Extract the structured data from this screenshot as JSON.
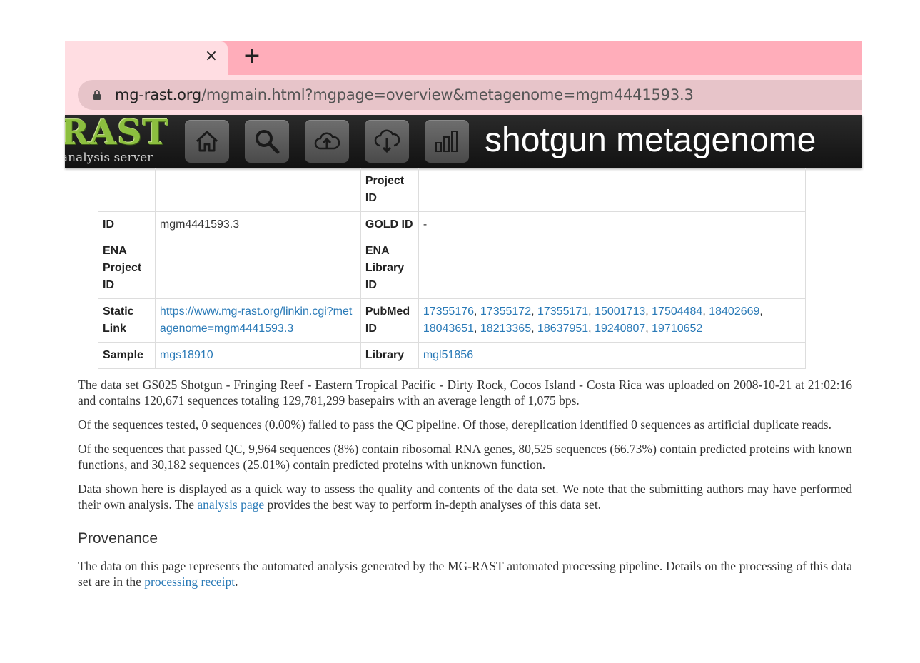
{
  "browser": {
    "tab_close_glyph": "×",
    "new_tab_glyph": "+",
    "url_host": "mg-rast.org",
    "url_path": "/mgmain.html?mgpage=overview&metagenome=mgm4441593.3"
  },
  "appbar": {
    "logo_text": "RAST",
    "logo_subtext": "analysis server",
    "title": "shotgun metagenome",
    "nav_icons": [
      "home-icon",
      "search-icon",
      "upload-icon",
      "download-icon",
      "bar-chart-icon"
    ]
  },
  "table": {
    "row0": {
      "k1": "",
      "v1": "",
      "k2": "Project ID",
      "v2": ""
    },
    "row1": {
      "k1": "ID",
      "v1": "mgm4441593.3",
      "k2": "GOLD ID",
      "v2": "-"
    },
    "row2": {
      "k1": "ENA Project ID",
      "v1": "",
      "k2": "ENA Library ID",
      "v2": ""
    },
    "row3": {
      "k1": "Static Link",
      "v1": "https://www.mg-rast.org/linkin.cgi?metagenome=mgm4441593.3",
      "k2": "PubMed ID",
      "pubmed": [
        "17355176",
        "17355172",
        "17355171",
        "15001713",
        "17504484",
        "18402669",
        "18043651",
        "18213365",
        "18637951",
        "19240807",
        "19710652"
      ]
    },
    "row4": {
      "k1": "Sample",
      "v1": "mgs18910",
      "k2": "Library",
      "v2": "mgl51856"
    }
  },
  "content": {
    "p1": "The data set GS025 Shotgun - Fringing Reef - Eastern Tropical Pacific - Dirty Rock, Cocos Island - Costa Rica was uploaded on 2008-10-21 at 21:02:16 and contains 120,671 sequences totaling 129,781,299 basepairs with an average length of 1,075 bps.",
    "p2": "Of the sequences tested, 0 sequences (0.00%) failed to pass the QC pipeline. Of those, dereplication identified 0 sequences as artificial duplicate reads.",
    "p3": "Of the sequences that passed QC, 9,964 sequences (8%) contain ribosomal RNA genes, 80,525 sequences (66.73%) contain predicted proteins with known functions, and 30,182 sequences (25.01%) contain predicted proteins with unknown function.",
    "p4_before": "Data shown here is displayed as a quick way to assess the quality and contents of the data set. We note that the submitting authors may have performed their own analysis. The ",
    "p4_link": "analysis page",
    "p4_after": " provides the best way to perform in-depth analyses of this data set.",
    "provenance_heading": "Provenance",
    "p5_before": "The data on this page represents the automated analysis generated by the MG-RAST automated processing pipeline. Details on the processing of this data set are in the ",
    "p5_link": "processing receipt",
    "p5_after": "."
  }
}
